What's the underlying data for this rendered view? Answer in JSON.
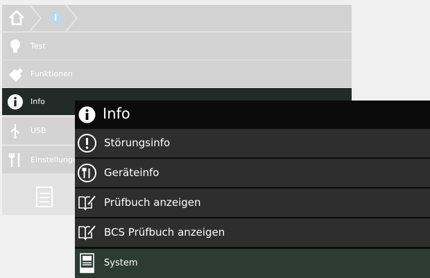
{
  "background_menu": {
    "items": [
      {
        "label": "Test",
        "icon": "lightbulb-icon"
      },
      {
        "label": "Funktionen",
        "icon": "wrench-icon"
      },
      {
        "label": "Info",
        "icon": "info-icon"
      },
      {
        "label": "USB",
        "icon": "usb-icon"
      },
      {
        "label": "Einstellungen",
        "icon": "tools-icon"
      }
    ]
  },
  "popup": {
    "title": "Info",
    "items": [
      {
        "label": "Störungsinfo",
        "icon": "exclamation-circle-icon"
      },
      {
        "label": "Geräteinfo",
        "icon": "device-tools-circle-icon"
      },
      {
        "label": "Prüfbuch anzeigen",
        "icon": "book-pen-icon"
      },
      {
        "label": "BCS Prüfbuch anzeigen",
        "icon": "book-pen-icon"
      },
      {
        "label": "System",
        "icon": "system-device-icon"
      }
    ]
  },
  "colors": {
    "active_row": "#222b27",
    "popup_bg": "#0c0c0c",
    "popup_row": "#2e2e2e",
    "system_row": "#2d3b35"
  }
}
